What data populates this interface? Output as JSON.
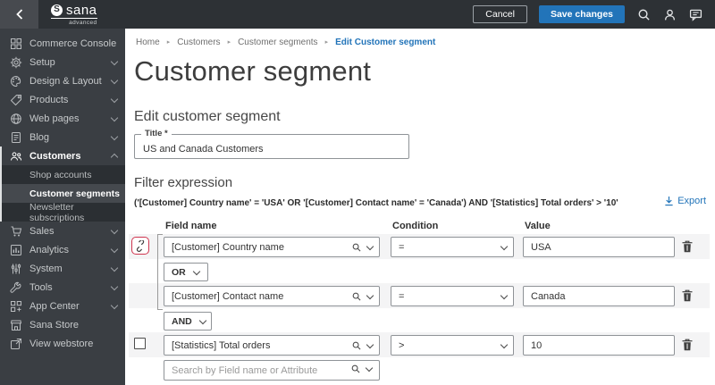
{
  "colors": {
    "accent_blue": "#2274b9",
    "danger_red": "#cf3650"
  },
  "topbar": {
    "brand": "sana",
    "brand_sub": "advanced",
    "cancel_label": "Cancel",
    "save_label": "Save changes"
  },
  "sidebar": {
    "items": [
      {
        "label": "Commerce Console"
      },
      {
        "label": "Setup"
      },
      {
        "label": "Design & Layout"
      },
      {
        "label": "Products"
      },
      {
        "label": "Web pages"
      },
      {
        "label": "Blog"
      },
      {
        "label": "Customers"
      },
      {
        "label": "Sales"
      },
      {
        "label": "Analytics"
      },
      {
        "label": "System"
      },
      {
        "label": "Tools"
      },
      {
        "label": "App Center"
      },
      {
        "label": "Sana Store"
      },
      {
        "label": "View webstore"
      }
    ],
    "submenu": [
      {
        "label": "Shop accounts"
      },
      {
        "label": "Customer segments"
      },
      {
        "label": "Newsletter subscriptions"
      }
    ]
  },
  "breadcrumb": {
    "items": [
      "Home",
      "Customers",
      "Customer segments",
      "Edit Customer segment"
    ]
  },
  "page": {
    "title": "Customer segment",
    "section_title": "Edit customer segment",
    "title_field": {
      "label": "Title",
      "required_marker": "*",
      "value": "US and Canada Customers"
    }
  },
  "filter": {
    "heading": "Filter expression",
    "expression": "('[Customer] Country name' = 'USA' OR '[Customer] Contact name' = 'Canada') AND '[Statistics] Total orders' > '10'",
    "export_label": "Export",
    "columns": {
      "field": "Field name",
      "condition": "Condition",
      "value": "Value"
    },
    "rows": [
      {
        "field": "[Customer] Country name",
        "condition": "=",
        "value": "USA"
      },
      {
        "field": "[Customer] Contact name",
        "condition": "=",
        "value": "Canada"
      },
      {
        "field": "[Statistics] Total orders",
        "condition": ">",
        "value": "10"
      }
    ],
    "operators": {
      "first": "OR",
      "second": "AND"
    },
    "search_placeholder": "Search by Field name or Attribute"
  }
}
